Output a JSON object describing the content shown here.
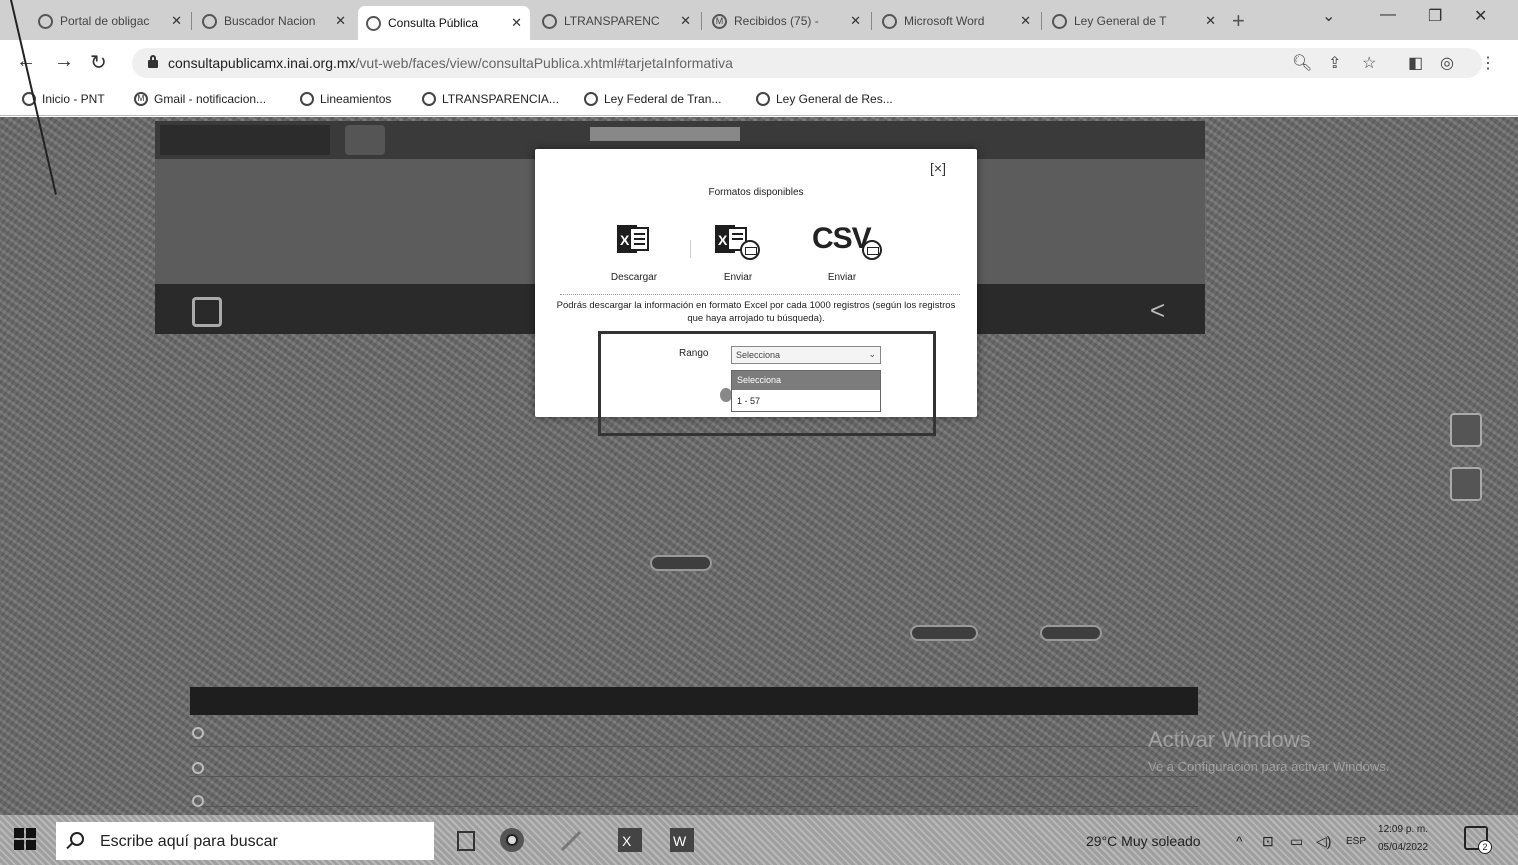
{
  "browser": {
    "tabs": [
      {
        "title": "Portal de obligac",
        "active": false
      },
      {
        "title": "Buscador Nacion",
        "active": false
      },
      {
        "title": "Consulta Pública",
        "active": true
      },
      {
        "title": "LTRANSPARENC",
        "active": false
      },
      {
        "title": "Recibidos (75) -",
        "active": false
      },
      {
        "title": "Microsoft Word",
        "active": false
      },
      {
        "title": "Ley General de T",
        "active": false
      }
    ],
    "url_host": "consultapublicamx.inai.org.mx",
    "url_path": "/vut-web/faces/view/consultaPublica.xhtml#tarjetaInformativa",
    "bookmarks": [
      {
        "label": "Inicio - PNT"
      },
      {
        "label": "Gmail - notificacion..."
      },
      {
        "label": "Lineamientos"
      },
      {
        "label": "LTRANSPARENCIA..."
      },
      {
        "label": "Ley Federal de Tran..."
      },
      {
        "label": "Ley General de Res..."
      }
    ]
  },
  "modal": {
    "close_label": "[×]",
    "title": "Formatos disponibles",
    "formats": [
      {
        "label": "Descargar",
        "icon": "excel-icon"
      },
      {
        "label": "Enviar",
        "icon": "excel-mail-icon"
      },
      {
        "label": "Enviar",
        "icon": "csv-mail-icon"
      }
    ],
    "csv_text": "CSV",
    "note": "Podrás descargar la información en formato Excel por cada 1000 registros (según los registros que haya arrojado tu búsqueda).",
    "range_label": "Rango",
    "range_value": "Selecciona",
    "range_options": [
      "Selecciona",
      "1 - 57"
    ]
  },
  "page": {
    "watermark_title": "Activar Windows",
    "watermark_sub": "Ve a Configuración para activar Windows."
  },
  "taskbar": {
    "search_placeholder": "Escribe aquí para buscar",
    "weather": "29°C  Muy soleado",
    "language": "ESP",
    "time": "12:09 p. m.",
    "date": "05/04/2022",
    "notifications": "2"
  },
  "colors": {
    "overlay": "#6a6a6a",
    "excel": "#1e1e1e"
  }
}
